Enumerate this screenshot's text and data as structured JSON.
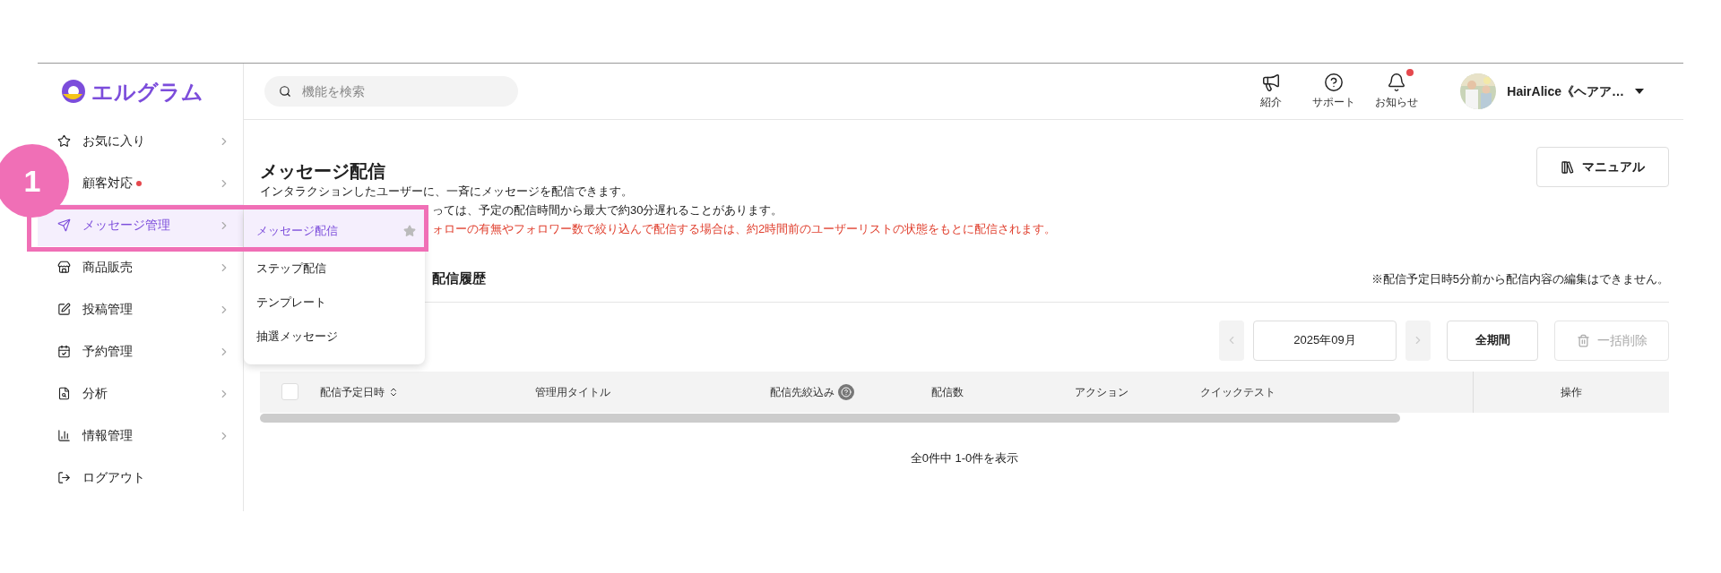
{
  "logo": {
    "text": "エルグラム"
  },
  "search": {
    "placeholder": "機能を検索"
  },
  "header_actions": [
    {
      "label": "紹介",
      "badge": false
    },
    {
      "label": "サポート",
      "badge": false
    },
    {
      "label": "お知らせ",
      "badge": true
    }
  ],
  "account": {
    "name": "HairAlice《ヘアア…"
  },
  "sidebar": {
    "items": [
      {
        "label": "お気に入り",
        "selected": false,
        "badge": false
      },
      {
        "label": "顧客対応",
        "selected": false,
        "badge": true
      },
      {
        "label": "メッセージ管理",
        "selected": true,
        "badge": false
      },
      {
        "label": "商品販売",
        "selected": false,
        "badge": false
      },
      {
        "label": "投稿管理",
        "selected": false,
        "badge": false
      },
      {
        "label": "予約管理",
        "selected": false,
        "badge": false
      },
      {
        "label": "分析",
        "selected": false,
        "badge": false
      },
      {
        "label": "情報管理",
        "selected": false,
        "badge": false
      },
      {
        "label": "ログアウト",
        "selected": false,
        "badge": false
      }
    ]
  },
  "submenu": {
    "items": [
      {
        "label": "メッセージ配信",
        "selected": true
      },
      {
        "label": "ステップ配信",
        "selected": false
      },
      {
        "label": "テンプレート",
        "selected": false
      },
      {
        "label": "抽選メッセージ",
        "selected": false
      }
    ]
  },
  "page": {
    "title": "メッセージ配信",
    "manual_button": "マニュアル",
    "description": [
      {
        "text": "インタラクションしたユーザーに、一斉にメッセージを配信できます。",
        "kind": "normal"
      },
      {
        "text": "っては、予定の配信時間から最大で約30分遅れることがあります。",
        "kind": "normal"
      },
      {
        "text": "ォローの有無やフォロワー数で絞り込んで配信する場合は、約2時間前のユーザーリストの状態をもとに配信されます。",
        "kind": "warning"
      }
    ],
    "section_title": "配信履歴",
    "notice": "※配信予定日時5分前から配信内容の編集はできません。"
  },
  "toolbar": {
    "month": "2025年09月",
    "all_period": "全期間",
    "bulk_delete": "一括削除",
    "bulk_delete_disabled": true
  },
  "table": {
    "select_all_checked": false,
    "columns": [
      {
        "label": "配信予定日時",
        "kind": "sortable"
      },
      {
        "label": "管理用タイトル",
        "kind": "plain"
      },
      {
        "label": "配信先絞込み",
        "kind": "help"
      },
      {
        "label": "配信数",
        "kind": "plain"
      },
      {
        "label": "アクション",
        "kind": "plain"
      },
      {
        "label": "クイックテスト",
        "kind": "plain"
      }
    ],
    "action_column": "操作"
  },
  "pagination": "全0件中 1-0件を表示",
  "annotation": {
    "step": "1"
  }
}
